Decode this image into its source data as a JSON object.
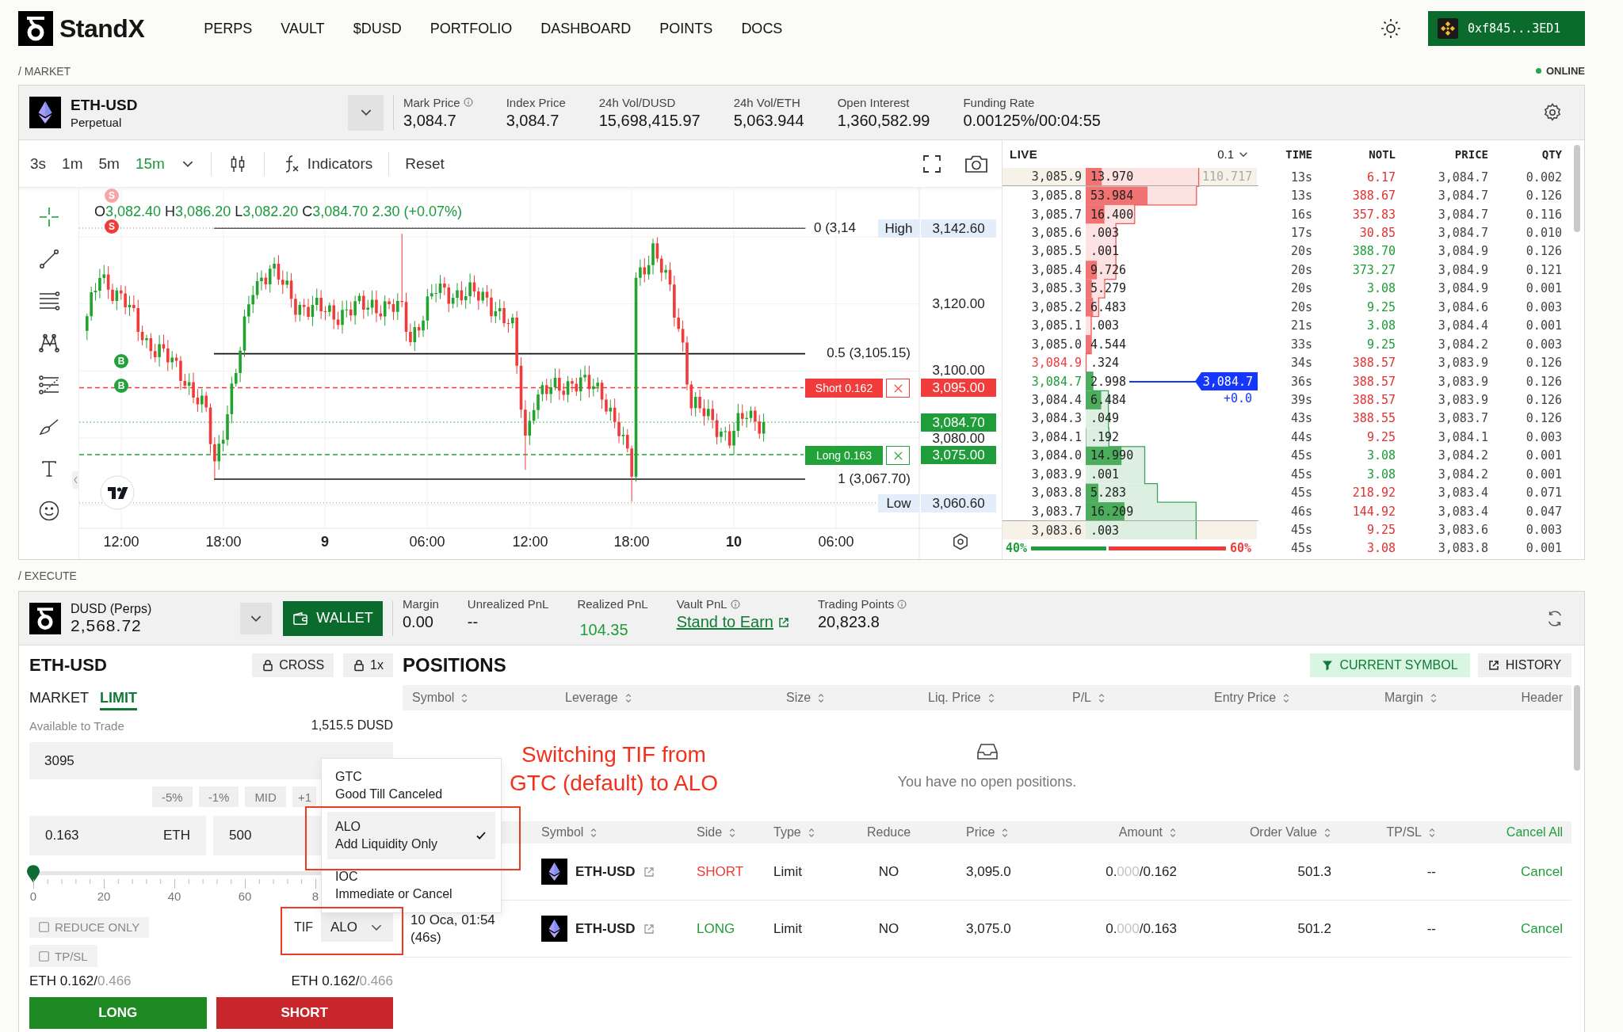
{
  "header": {
    "brand": "StandX",
    "nav": [
      "PERPS",
      "VAULT",
      "$DUSD",
      "PORTFOLIO",
      "DASHBOARD",
      "POINTS",
      "DOCS"
    ],
    "wallet": "0xf845...3ED1"
  },
  "market_section": {
    "label": "/ MARKET",
    "status": "ONLINE",
    "online": true
  },
  "market_bar": {
    "symbol": "ETH-USD",
    "market_type": "Perpetual",
    "stats": [
      {
        "label": "Mark Price",
        "info": true,
        "value": "3,084.7"
      },
      {
        "label": "Index Price",
        "info": false,
        "value": "3,084.7"
      },
      {
        "label": "24h Vol/DUSD",
        "info": false,
        "value": "15,698,415.97"
      },
      {
        "label": "24h Vol/ETH",
        "info": false,
        "value": "5,063.944"
      },
      {
        "label": "Open Interest",
        "info": false,
        "value": "1,360,582.99"
      },
      {
        "label": "Funding Rate",
        "info": false,
        "value": "0.00125%/00:04:55"
      }
    ]
  },
  "chart": {
    "intervals": [
      {
        "label": "3s",
        "selected": false
      },
      {
        "label": "1m",
        "selected": false
      },
      {
        "label": "5m",
        "selected": false
      },
      {
        "label": "15m",
        "selected": true
      }
    ],
    "indicators_button": "Indicators",
    "reset_button": "Reset",
    "legend": [
      {
        "key": "O",
        "value": "3,082.40"
      },
      {
        "key": "H",
        "value": "3,086.20"
      },
      {
        "key": "L",
        "value": "3,082.20"
      },
      {
        "key": "C",
        "value": "3,084.70"
      }
    ],
    "legend_change": "2.30 (+0.07%)",
    "markers": [
      {
        "label": "S",
        "kind": "sell",
        "faded": true
      },
      {
        "label": "S",
        "kind": "sell",
        "faded": false
      },
      {
        "label": "B",
        "kind": "buy",
        "faded": false
      },
      {
        "label": "B",
        "kind": "buy",
        "faded": false
      }
    ],
    "fib_levels": [
      "0 (3,14",
      "0.5 (3,105.15)",
      "1 (3,067.70)"
    ],
    "price_axis": [
      "3,120.00",
      "3,100.00",
      "3,080.00"
    ],
    "time_axis": [
      {
        "label": "12:00",
        "kind": "time"
      },
      {
        "label": "18:00",
        "kind": "time"
      },
      {
        "label": "9",
        "kind": "day"
      },
      {
        "label": "06:00",
        "kind": "time"
      },
      {
        "label": "12:00",
        "kind": "time"
      },
      {
        "label": "18:00",
        "kind": "time"
      },
      {
        "label": "10",
        "kind": "day"
      },
      {
        "label": "06:00",
        "kind": "time"
      }
    ],
    "high": {
      "label": "High",
      "value": "3,142.60"
    },
    "low": {
      "label": "Low",
      "value": "3,060.60"
    },
    "order_lines": [
      {
        "kind": "short",
        "label": "Short 0.162",
        "price": "3,095.00"
      },
      {
        "kind": "long",
        "label": "Long 0.163",
        "price": "3,075.00"
      }
    ],
    "last_price": "3,084.70"
  },
  "order_book": {
    "title": "LIVE",
    "tick": "0.1",
    "asks": [
      {
        "price": "3,085.9",
        "size": "13.970",
        "best": false,
        "highlighted": true,
        "total": "110.717"
      },
      {
        "price": "3,085.8",
        "size": "53.984",
        "best": false,
        "highlighted": false
      },
      {
        "price": "3,085.7",
        "size": "16.400",
        "best": false,
        "highlighted": false
      },
      {
        "price": "3,085.6",
        "size": ".003",
        "best": false,
        "highlighted": false
      },
      {
        "price": "3,085.5",
        "size": ".001",
        "best": false,
        "highlighted": false
      },
      {
        "price": "3,085.4",
        "size": "9.726",
        "best": false,
        "highlighted": false
      },
      {
        "price": "3,085.3",
        "size": "5.279",
        "best": false,
        "highlighted": false
      },
      {
        "price": "3,085.2",
        "size": "6.483",
        "best": false,
        "highlighted": false
      },
      {
        "price": "3,085.1",
        "size": ".003",
        "best": false,
        "highlighted": false
      },
      {
        "price": "3,085.0",
        "size": "4.544",
        "best": false,
        "highlighted": false
      },
      {
        "price": "3,084.9",
        "size": ".324",
        "best": true,
        "highlighted": false
      }
    ],
    "bids": [
      {
        "price": "3,084.7",
        "size": "2.998",
        "best": true,
        "highlighted": false
      },
      {
        "price": "3,084.4",
        "size": "6.484",
        "best": false,
        "highlighted": false
      },
      {
        "price": "3,084.3",
        "size": ".049",
        "best": false,
        "highlighted": false
      },
      {
        "price": "3,084.1",
        "size": ".192",
        "best": false,
        "highlighted": false
      },
      {
        "price": "3,084.0",
        "size": "14.990",
        "best": false,
        "highlighted": false
      },
      {
        "price": "3,083.9",
        "size": ".001",
        "best": false,
        "highlighted": false
      },
      {
        "price": "3,083.8",
        "size": "5.283",
        "best": false,
        "highlighted": false
      },
      {
        "price": "3,083.7",
        "size": "16.209",
        "best": false,
        "highlighted": false
      },
      {
        "price": "3,083.6",
        "size": ".003",
        "best": false,
        "highlighted": true
      }
    ],
    "last_price": "3,084.7",
    "last_change": "+0.0",
    "balance": {
      "bid_share": "40%",
      "ask_share": "60%",
      "level": 0.4
    }
  },
  "trades": {
    "columns": [
      "TIME",
      "NOTL",
      "PRICE",
      "QTY"
    ],
    "rows": [
      {
        "time": "13s",
        "notional": "6.17",
        "price": "3,084.7",
        "qty": "0.002",
        "kind": "sell"
      },
      {
        "time": "13s",
        "notional": "388.67",
        "price": "3,084.7",
        "qty": "0.126",
        "kind": "sell"
      },
      {
        "time": "16s",
        "notional": "357.83",
        "price": "3,084.7",
        "qty": "0.116",
        "kind": "sell"
      },
      {
        "time": "17s",
        "notional": "30.85",
        "price": "3,084.7",
        "qty": "0.010",
        "kind": "sell"
      },
      {
        "time": "20s",
        "notional": "388.70",
        "price": "3,084.9",
        "qty": "0.126",
        "kind": "buy"
      },
      {
        "time": "20s",
        "notional": "373.27",
        "price": "3,084.9",
        "qty": "0.121",
        "kind": "buy"
      },
      {
        "time": "20s",
        "notional": "3.08",
        "price": "3,084.9",
        "qty": "0.001",
        "kind": "buy"
      },
      {
        "time": "20s",
        "notional": "9.25",
        "price": "3,084.6",
        "qty": "0.003",
        "kind": "buy"
      },
      {
        "time": "21s",
        "notional": "3.08",
        "price": "3,084.4",
        "qty": "0.001",
        "kind": "buy"
      },
      {
        "time": "33s",
        "notional": "9.25",
        "price": "3,084.2",
        "qty": "0.003",
        "kind": "buy"
      },
      {
        "time": "34s",
        "notional": "388.57",
        "price": "3,083.9",
        "qty": "0.126",
        "kind": "sell"
      },
      {
        "time": "36s",
        "notional": "388.57",
        "price": "3,083.9",
        "qty": "0.126",
        "kind": "sell"
      },
      {
        "time": "39s",
        "notional": "388.57",
        "price": "3,083.9",
        "qty": "0.126",
        "kind": "sell"
      },
      {
        "time": "43s",
        "notional": "388.55",
        "price": "3,083.7",
        "qty": "0.126",
        "kind": "sell"
      },
      {
        "time": "44s",
        "notional": "9.25",
        "price": "3,084.1",
        "qty": "0.003",
        "kind": "sell"
      },
      {
        "time": "45s",
        "notional": "3.08",
        "price": "3,084.2",
        "qty": "0.001",
        "kind": "buy"
      },
      {
        "time": "45s",
        "notional": "3.08",
        "price": "3,084.2",
        "qty": "0.001",
        "kind": "buy"
      },
      {
        "time": "45s",
        "notional": "218.92",
        "price": "3,083.4",
        "qty": "0.071",
        "kind": "sell"
      },
      {
        "time": "46s",
        "notional": "144.92",
        "price": "3,083.4",
        "qty": "0.047",
        "kind": "sell"
      },
      {
        "time": "45s",
        "notional": "9.25",
        "price": "3,083.6",
        "qty": "0.003",
        "kind": "sell"
      },
      {
        "time": "45s",
        "notional": "3.08",
        "price": "3,083.8",
        "qty": "0.001",
        "kind": "sell"
      }
    ]
  },
  "execute_section": {
    "label": "/ EXECUTE"
  },
  "account_bar": {
    "asset": "DUSD (Perps)",
    "balance": "2,568.72",
    "wallet_button": "WALLET",
    "stats": [
      {
        "label": "Margin",
        "info": false,
        "value": "0.00",
        "kind": "plain"
      },
      {
        "label": "Unrealized PnL",
        "info": false,
        "value": "--",
        "kind": "plain"
      },
      {
        "label": "Realized PnL",
        "info": false,
        "value": "104.35",
        "kind": "positive"
      },
      {
        "label": "Vault PnL",
        "info": true,
        "value": "Stand to Earn",
        "kind": "link"
      },
      {
        "label": "Trading Points",
        "info": true,
        "value": "20,823.8",
        "kind": "plain"
      }
    ]
  },
  "order_form": {
    "symbol": "ETH-USD",
    "margin_mode": "CROSS",
    "leverage": "1x",
    "order_types": [
      {
        "label": "MARKET",
        "selected": false
      },
      {
        "label": "LIMIT",
        "selected": true
      }
    ],
    "available_label": "Available to Trade",
    "available_value": "1,515.5 DUSD",
    "price": "3095",
    "price_adjust": [
      "-5%",
      "-1%",
      "MID",
      "+1"
    ],
    "size": "0.163",
    "size_unit": "ETH",
    "notional": "500",
    "slider": {
      "level": 0,
      "labels": [
        "0",
        "20",
        "40",
        "60",
        "8"
      ]
    },
    "reduce_only": {
      "label": "REDUCE ONLY",
      "checked": false
    },
    "tpsl": {
      "label": "TP/SL",
      "checked": false
    },
    "tif": {
      "label": "TIF",
      "value": "ALO"
    },
    "max_sizes": [
      {
        "text": "ETH 0.162/",
        "faded": "0.466"
      },
      {
        "text": "ETH 0.162/",
        "faded": "0.466"
      }
    ],
    "actions": [
      {
        "label": "LONG",
        "kind": "long"
      },
      {
        "label": "SHORT",
        "kind": "short"
      }
    ]
  },
  "tif_menu": {
    "open": true,
    "options": [
      {
        "code": "GTC",
        "name": "Good Till Canceled",
        "selected": false
      },
      {
        "code": "ALO",
        "name": "Add Liquidity Only",
        "selected": true
      },
      {
        "code": "IOC",
        "name": "Immediate or Cancel",
        "selected": false
      }
    ]
  },
  "positions": {
    "title": "POSITIONS",
    "filter_button": "CURRENT SYMBOL",
    "history_button": "HISTORY",
    "columns": [
      {
        "label": "Symbol",
        "sortable": true
      },
      {
        "label": "Leverage",
        "sortable": true
      },
      {
        "label": "Size",
        "sortable": true
      },
      {
        "label": "Liq. Price",
        "sortable": true
      },
      {
        "label": "P/L",
        "sortable": true
      },
      {
        "label": "Entry Price",
        "sortable": true
      },
      {
        "label": "Margin",
        "sortable": true
      },
      {
        "label": "Header",
        "sortable": false
      }
    ],
    "empty_message": "You have no open positions."
  },
  "open_orders": {
    "columns": [
      {
        "label": "Symbol",
        "sortable": true
      },
      {
        "label": "Side",
        "sortable": true
      },
      {
        "label": "Type",
        "sortable": true
      },
      {
        "label": "Reduce",
        "sortable": false
      },
      {
        "label": "Price",
        "sortable": true
      },
      {
        "label": "Amount",
        "sortable": true
      },
      {
        "label": "Order Value",
        "sortable": true
      },
      {
        "label": "TP/SL",
        "sortable": true
      }
    ],
    "cancel_all": "Cancel All",
    "rows": [
      {
        "symbol": "ETH-USD",
        "side": "SHORT",
        "kind": "short",
        "type": "Limit",
        "reduce": "NO",
        "price": "3,095.0",
        "amount": {
          "lead": "0.",
          "faded": "000",
          "rest": "/0.162"
        },
        "order_value": "501.3",
        "tpsl": "--",
        "action": "Cancel"
      },
      {
        "time": "10 Oca, 01:54",
        "age": "(46s)",
        "symbol": "ETH-USD",
        "side": "LONG",
        "kind": "long",
        "type": "Limit",
        "reduce": "NO",
        "price": "3,075.0",
        "amount": {
          "lead": "0.",
          "faded": "000",
          "rest": "/0.163"
        },
        "order_value": "501.2",
        "tpsl": "--",
        "action": "Cancel"
      }
    ]
  },
  "annotation": {
    "lines": [
      "Switching TIF from",
      "GTC (default) to ALO"
    ]
  }
}
